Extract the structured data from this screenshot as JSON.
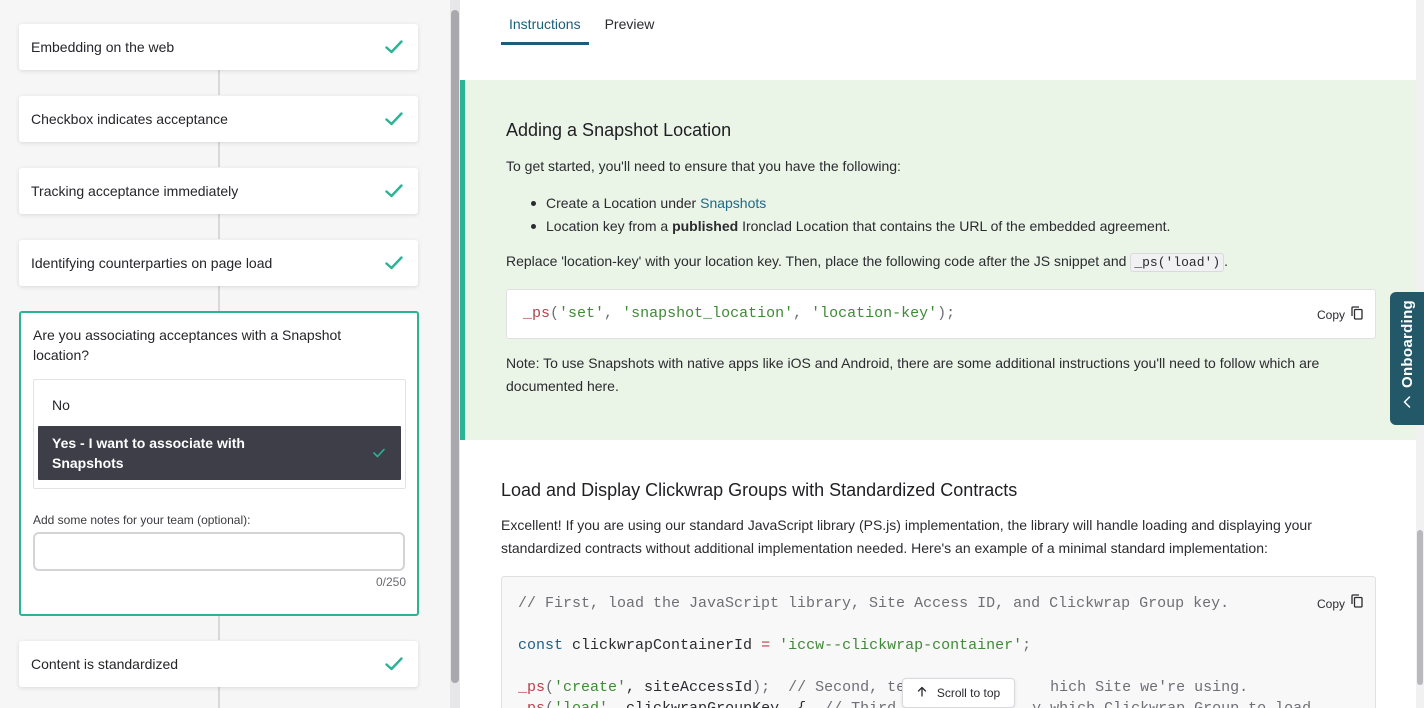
{
  "steps_above": [
    {
      "label": "Embedding on the web"
    },
    {
      "label": "Checkbox indicates acceptance"
    },
    {
      "label": "Tracking acceptance immediately"
    },
    {
      "label": "Identifying counterparties on page load"
    }
  ],
  "active_step": {
    "question": "Are you associating acceptances with a Snapshot location?",
    "options": [
      "No",
      "Yes - I want to associate with Snapshots"
    ],
    "selected_option": "Yes - I want to associate with Snapshots",
    "notes_label": "Add some notes for your team (optional):",
    "notes_value": "",
    "char_count": "0/250"
  },
  "steps_below": [
    {
      "label": "Content is standardized"
    }
  ],
  "tabs": [
    "Instructions",
    "Preview"
  ],
  "active_tab": "Instructions",
  "instructions": {
    "title": "Adding a Snapshot Location",
    "intro": "To get started, you'll need to ensure that you have the following:",
    "bullet1_prefix": "Create a Location under ",
    "bullet1_link": "Snapshots",
    "bullet2_prefix": "Location key from a ",
    "bullet2_bold": "published",
    "bullet2_suffix": " Ironclad Location that contains the URL of the embedded agreement.",
    "replace_text": "Replace 'location-key' with your location key. Then, place the following code after the JS snippet and ",
    "replace_code": "_ps('load')",
    "replace_end": ".",
    "code": {
      "fn": "_ps",
      "open": "(",
      "arg1": "'set'",
      "arg2": "'snapshot_location'",
      "arg3": "'location-key'",
      "close": ");",
      "sep": ", "
    },
    "copy_label": "Copy",
    "note": "Note: To use Snapshots with native apps like iOS and Android, there are some additional instructions you'll need to follow which are documented here."
  },
  "load_section": {
    "title": "Load and Display Clickwrap Groups with Standardized Contracts",
    "description": "Excellent! If you are using our standard JavaScript library (PS.js) implementation, the library will handle loading and displaying your standardized contracts without additional implementation needed. Here's an example of a minimal standard implementation:",
    "copy_label": "Copy",
    "comment1": "// First, load the JavaScript library, Site Access ID, and Clickwrap Group key.",
    "const_kw": "const",
    "const_name": " clickwrapContainerId ",
    "const_eq": "=",
    "const_val": " 'iccw--clickwrap-container'",
    "const_end": ";",
    "create_fn": "_ps",
    "create_open": "(",
    "create_arg": "'create'",
    "create_rest": ", siteAccessId",
    "create_close": ");",
    "create_comment": "  // Second, tell ",
    "create_comment_tail": "hich Site we're using.",
    "load_fn": "_ps",
    "load_open": "(",
    "load_arg": "'load'",
    "load_rest": ", clickwrapGroupKey, {",
    "load_comment": "  // Third, te",
    "load_comment_tail": "y which Clickwrap Group to load"
  },
  "scroll_to_top_label": "Scroll to top",
  "onboarding_label": "Onboarding",
  "colors": {
    "accent_green": "#2bb394",
    "selected_option_bg": "#3d3e48",
    "instructions_bg": "#eaf4e7",
    "link": "#1d6a86",
    "onboarding_bg": "#235868"
  }
}
